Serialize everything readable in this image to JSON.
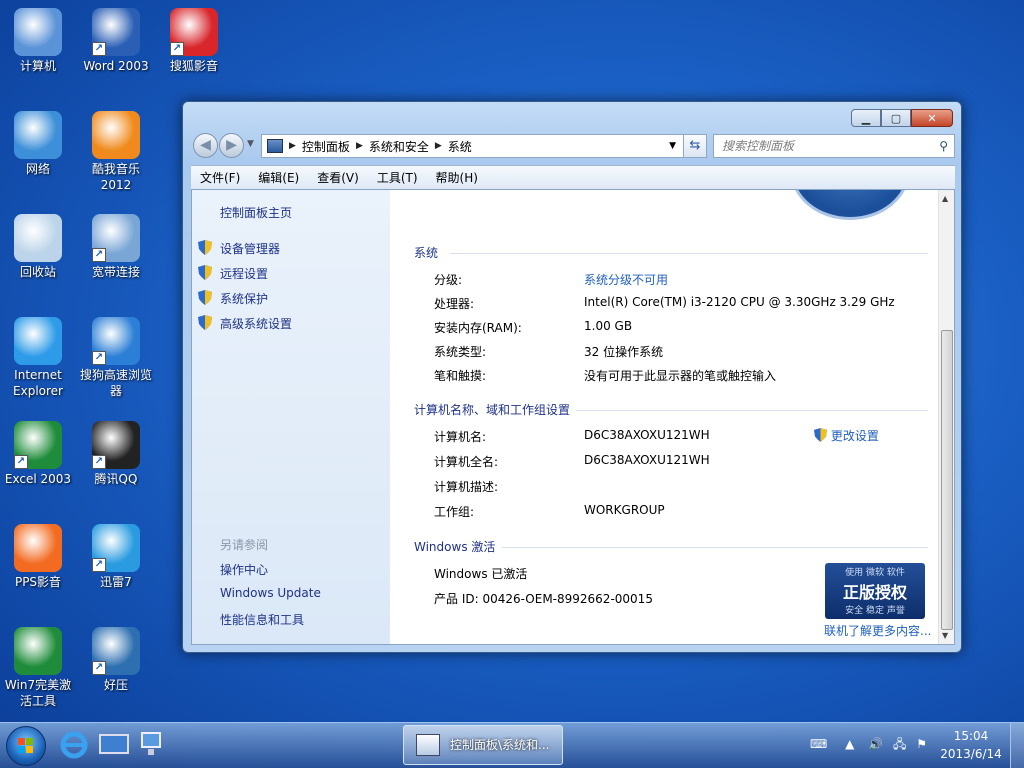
{
  "desktop_icons": [
    {
      "label": "计算机",
      "icon": "computer-icon"
    },
    {
      "label": "Word 2003",
      "icon": "word-icon"
    },
    {
      "label": "搜狐影音",
      "icon": "sohu-video-icon"
    },
    {
      "label": "网络",
      "icon": "network-icon"
    },
    {
      "label": "酷我音乐 2012",
      "icon": "kuwo-music-icon"
    },
    {
      "label": "回收站",
      "icon": "recycle-bin-icon"
    },
    {
      "label": "宽带连接",
      "icon": "broadband-icon"
    },
    {
      "label": "Internet Explorer",
      "icon": "ie-icon"
    },
    {
      "label": "搜狗高速浏览器",
      "icon": "sogou-browser-icon"
    },
    {
      "label": "Excel 2003",
      "icon": "excel-icon"
    },
    {
      "label": "腾讯QQ",
      "icon": "qq-icon"
    },
    {
      "label": "PPS影音",
      "icon": "pps-icon"
    },
    {
      "label": "迅雷7",
      "icon": "xunlei-icon"
    },
    {
      "label": "Win7完美激活工具",
      "icon": "activation-tool-icon"
    },
    {
      "label": "好压",
      "icon": "haozip-icon"
    }
  ],
  "window": {
    "breadcrumb": [
      "控制面板",
      "系统和安全",
      "系统"
    ],
    "search_placeholder": "搜索控制面板",
    "menu": [
      "文件(F)",
      "编辑(E)",
      "查看(V)",
      "工具(T)",
      "帮助(H)"
    ]
  },
  "left_pane": {
    "home": "控制面板主页",
    "tasks": [
      "设备管理器",
      "远程设置",
      "系统保护",
      "高级系统设置"
    ],
    "see_also_heading": "另请参阅",
    "see_also": [
      "操作中心",
      "Windows Update",
      "性能信息和工具"
    ]
  },
  "system": {
    "heading": "系统",
    "rows": [
      {
        "label": "分级:",
        "value": "系统分级不可用",
        "link": true
      },
      {
        "label": "处理器:",
        "value": "Intel(R) Core(TM) i3-2120 CPU @ 3.30GHz   3.29 GHz"
      },
      {
        "label": "安装内存(RAM):",
        "value": "1.00 GB"
      },
      {
        "label": "系统类型:",
        "value": "32 位操作系统"
      },
      {
        "label": "笔和触摸:",
        "value": "没有可用于此显示器的笔或触控输入"
      }
    ]
  },
  "computer_name": {
    "heading": "计算机名称、域和工作组设置",
    "change_settings": "更改设置",
    "rows": [
      {
        "label": "计算机名:",
        "value": "D6C38AXOXU121WH"
      },
      {
        "label": "计算机全名:",
        "value": "D6C38AXOXU121WH"
      },
      {
        "label": "计算机描述:",
        "value": ""
      },
      {
        "label": "工作组:",
        "value": "WORKGROUP"
      }
    ]
  },
  "activation": {
    "heading": "Windows 激活",
    "status": "Windows 已激活",
    "product_id": "产品 ID: 00426-OEM-8992662-00015",
    "badge_top": "使用 微软 软件",
    "badge_main": "正版授权",
    "badge_sub": "安全 稳定 声誉",
    "more_link": "联机了解更多内容..."
  },
  "taskbar": {
    "task_label": "控制面板\\系统和...",
    "time": "15:04",
    "date": "2013/6/14"
  },
  "colors": {
    "link": "#1e5fbf",
    "nav_link": "#1e3287",
    "desktop": "#1a5fc4"
  }
}
